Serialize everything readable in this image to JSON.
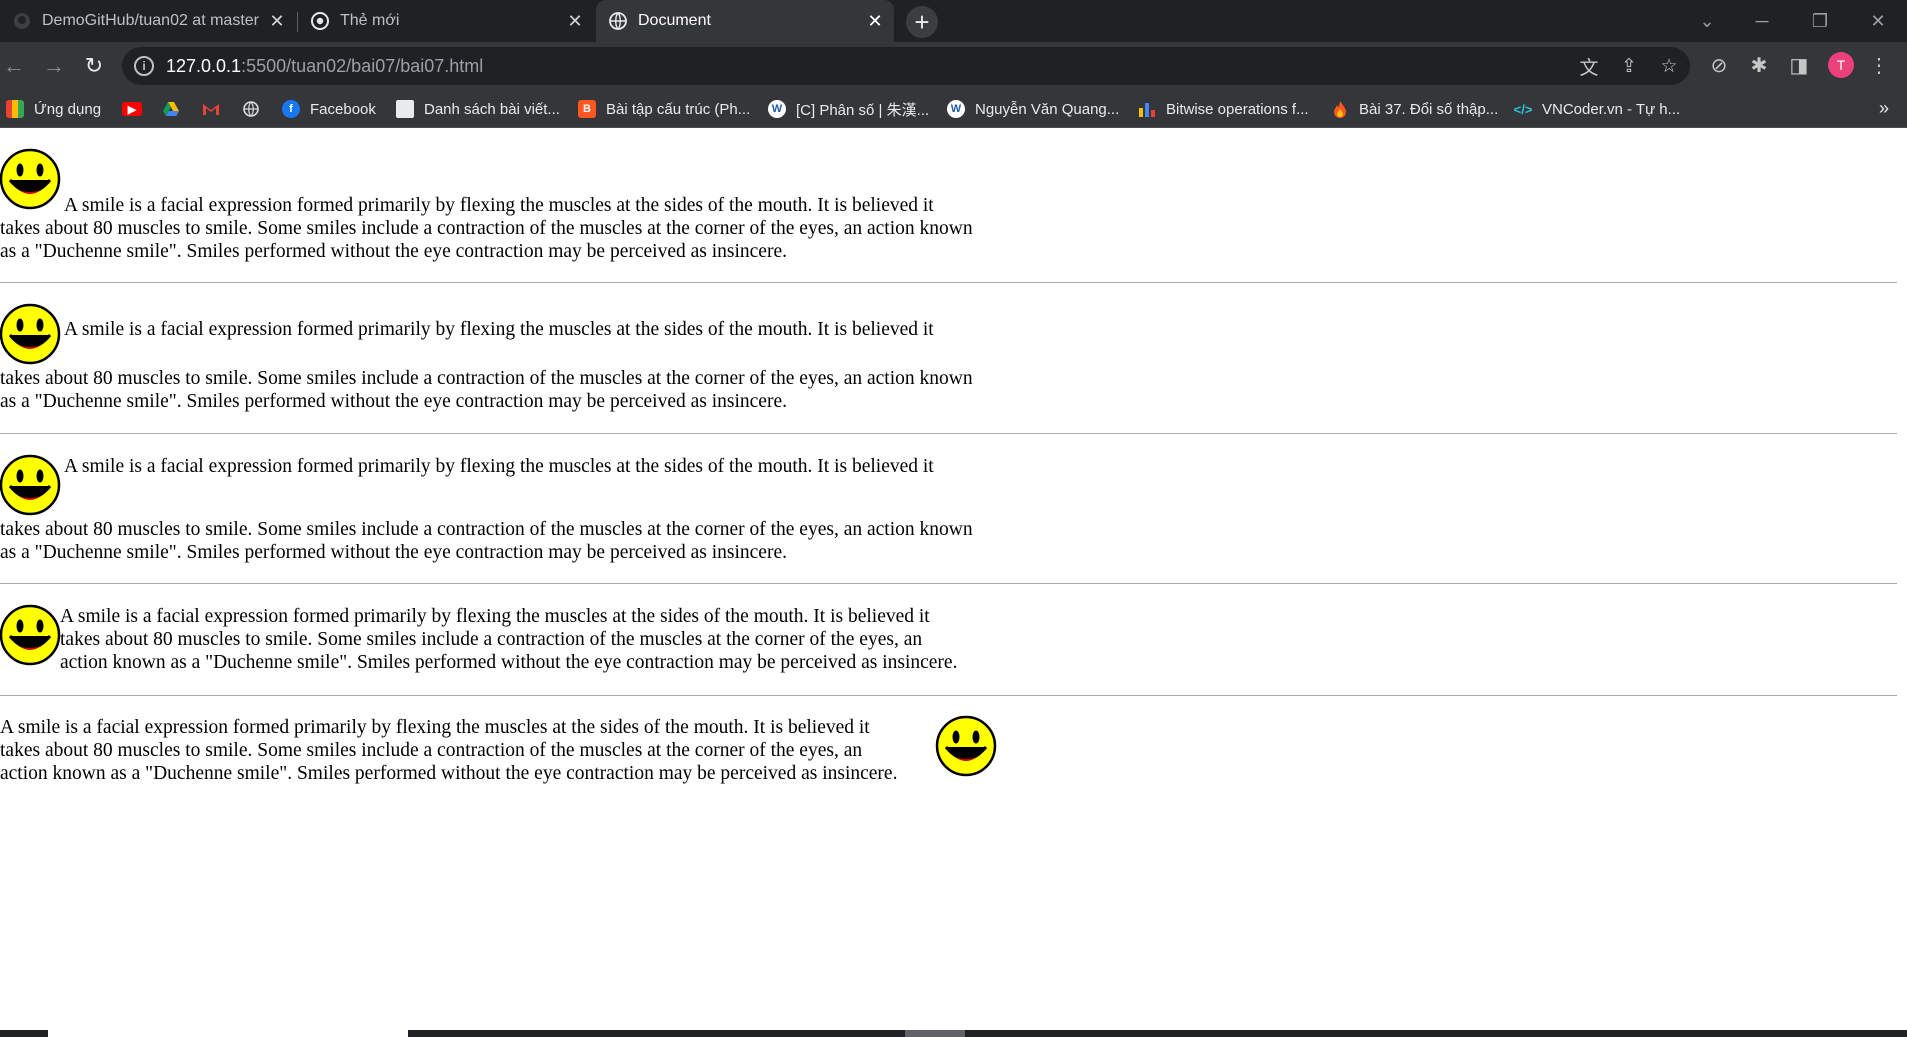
{
  "browser": {
    "tabs": [
      {
        "title": "DemoGitHub/tuan02 at master · ",
        "favicon": "github-icon"
      },
      {
        "title": "Thẻ mới",
        "favicon": "chrome-icon"
      },
      {
        "title": "Document",
        "favicon": "globe-icon",
        "active": true
      }
    ],
    "new_tab_label": "+",
    "url_host": "127.0.0.1",
    "url_rest": ":5500/tuan02/bai07/bai07.html",
    "avatar_letter": "T"
  },
  "bookmarks": [
    {
      "label": "Ứng dụng",
      "icon": "apps-grid-icon"
    },
    {
      "label": "",
      "icon": "youtube-icon"
    },
    {
      "label": "",
      "icon": "google-drive-icon"
    },
    {
      "label": "",
      "icon": "gmail-icon"
    },
    {
      "label": "",
      "icon": "globe-icon"
    },
    {
      "label": "Facebook",
      "icon": "facebook-icon"
    },
    {
      "label": "Danh sách bài viết...",
      "icon": "document-icon"
    },
    {
      "label": "Bài tập cấu trúc (Ph...",
      "icon": "blogger-icon"
    },
    {
      "label": "[C] Phân số | 朱漢...",
      "icon": "wordpress-icon"
    },
    {
      "label": "Nguyễn Văn Quang...",
      "icon": "wordpress-icon"
    },
    {
      "label": "Bitwise operations f...",
      "icon": "bar-chart-icon"
    },
    {
      "label": "Bài 37. Đổi số thập...",
      "icon": "flame-icon"
    },
    {
      "label": "VNCoder.vn - Tự h...",
      "icon": "code-icon"
    }
  ],
  "bookmarks_more": "»",
  "sections": [
    {
      "lines": [
        "A smile is a facial expression formed primarily by flexing the muscles at the sides of the mouth. It is believed it",
        "takes about 80 muscles to smile. Some smiles include a contraction of the muscles at the corner of the eyes, an action known",
        "as a \"Duchenne smile\". Smiles performed without the eye contraction may be perceived as insincere."
      ]
    },
    {
      "lines": [
        "A smile is a facial expression formed primarily by flexing the muscles at the sides of the mouth. It is believed it",
        "takes about 80 muscles to smile. Some smiles include a contraction of the muscles at the corner of the eyes, an action known",
        "as a \"Duchenne smile\". Smiles performed without the eye contraction may be perceived as insincere."
      ]
    },
    {
      "lines": [
        "A smile is a facial expression formed primarily by flexing the muscles at the sides of the mouth. It is believed it",
        "takes about 80 muscles to smile. Some smiles include a contraction of the muscles at the corner of the eyes, an action known",
        "as a \"Duchenne smile\". Smiles performed without the eye contraction may be perceived as insincere."
      ]
    },
    {
      "lines": [
        "A smile is a facial expression formed primarily by flexing the muscles at the sides of the mouth. It is believed it",
        "takes about 80 muscles to smile. Some smiles include a contraction of the muscles at the corner of the eyes, an",
        "action known as a \"Duchenne smile\". Smiles performed without the eye contraction may be perceived as insincere."
      ]
    },
    {
      "lines": [
        "A smile is a facial expression formed primarily by flexing the muscles at the sides of the mouth. It is believed it",
        "takes about 80 muscles to smile. Some smiles include a contraction of the muscles at the corner of the eyes, an",
        "action known as a \"Duchenne smile\". Smiles performed without the eye contraction may be perceived as insincere."
      ]
    }
  ],
  "colors": {
    "smiley_face": "#ffff00",
    "chrome_dark": "#202124",
    "toolbar": "#35363a"
  }
}
